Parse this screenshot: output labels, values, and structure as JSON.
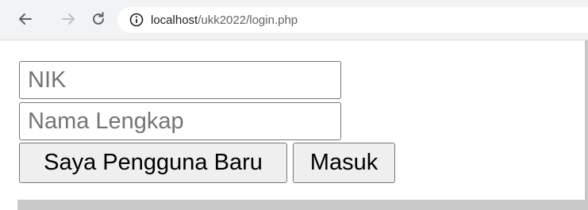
{
  "browser": {
    "url_host": "localhost",
    "url_path": "/ukk2022/login.php"
  },
  "form": {
    "nik_placeholder": "NIK",
    "nik_value": "",
    "nama_placeholder": "Nama Lengkap",
    "nama_value": "",
    "new_user_label": "Saya Pengguna Baru",
    "login_label": "Masuk"
  },
  "icons": {
    "back": "arrow-left-icon",
    "forward": "arrow-right-icon",
    "reload": "reload-icon",
    "info": "info-icon"
  }
}
